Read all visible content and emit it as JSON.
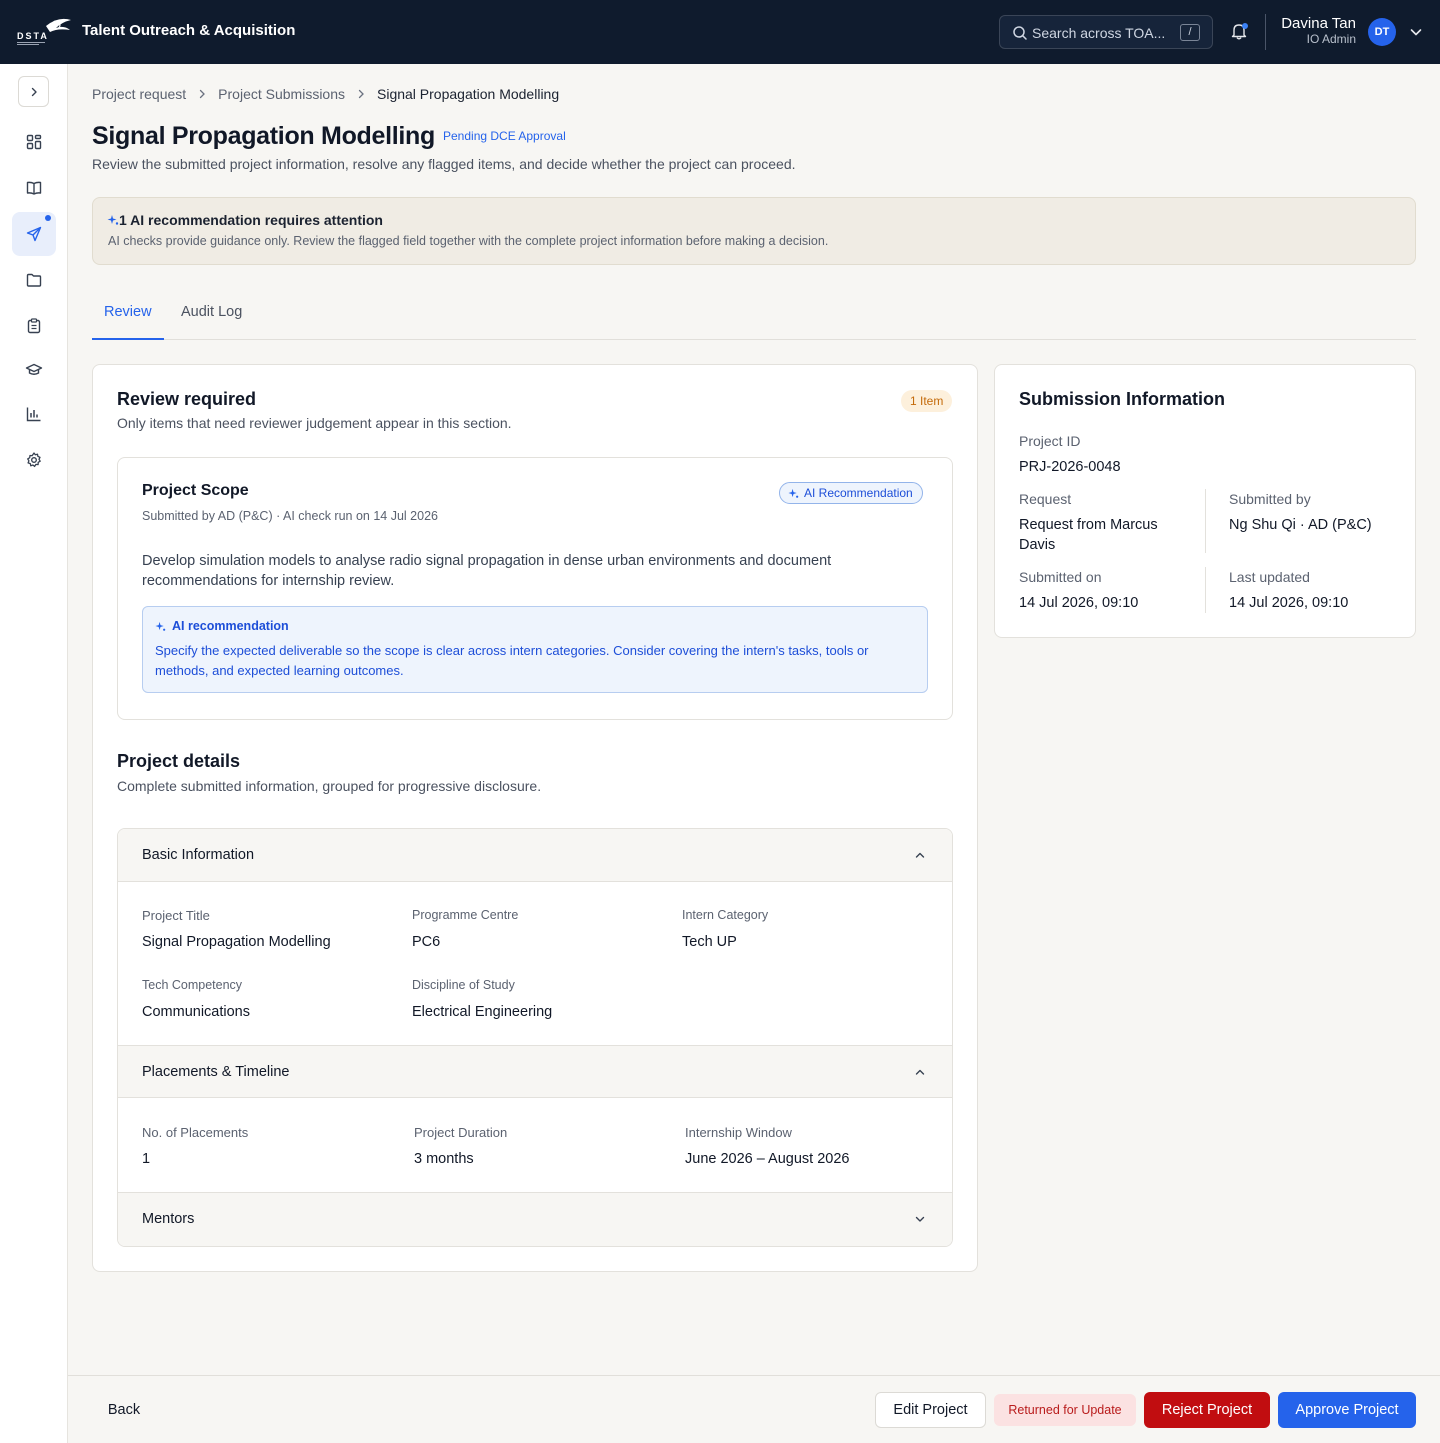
{
  "app": {
    "title": "Talent Outreach & Acquisition",
    "logo_text": "DSTA"
  },
  "search": {
    "placeholder": "Search across TOA...",
    "shortcut": "/"
  },
  "user": {
    "name": "Davina Tan",
    "role": "IO Admin",
    "initials": "DT"
  },
  "sidebar": {
    "items": [
      {
        "icon": "dashboard-icon",
        "active": false
      },
      {
        "icon": "book-icon",
        "active": false
      },
      {
        "icon": "send-icon",
        "active": true,
        "has_indicator": true
      },
      {
        "icon": "folder-icon",
        "active": false
      },
      {
        "icon": "clipboard-icon",
        "active": false
      },
      {
        "icon": "graduation-cap-icon",
        "active": false
      },
      {
        "icon": "bar-chart-icon",
        "active": false
      },
      {
        "icon": "gear-icon",
        "active": false
      }
    ]
  },
  "breadcrumb": [
    "Project request",
    "Project Submissions",
    "Signal Propagation Modelling"
  ],
  "page": {
    "title": "Signal Propagation Modelling",
    "status": "Pending DCE Approval",
    "subtitle": "Review the submitted project information, resolve any flagged items, and decide whether the project can proceed."
  },
  "alert": {
    "title": "1 AI recommendation requires attention",
    "text": "AI checks provide guidance only. Review the flagged field together with the complete project information before making a decision."
  },
  "tabs": [
    {
      "label": "Review",
      "active": true
    },
    {
      "label": "Audit Log",
      "active": false
    }
  ],
  "review": {
    "title": "Review required",
    "subtitle": "Only items that need reviewer judgement appear in this section.",
    "count_badge": "1 Item",
    "item": {
      "title": "Project Scope",
      "meta": "Submitted by AD (P&C) · AI check run on 14 Jul 2026",
      "pill": "AI Recommendation",
      "description": "Develop simulation models to analyse radio signal propagation in dense urban environments and document recommendations for internship review.",
      "ai_heading": "AI recommendation",
      "ai_text": "Specify the expected deliverable so the scope is clear across intern categories. Consider covering the intern's tasks, tools or methods, and expected learning outcomes."
    }
  },
  "details": {
    "title": "Project details",
    "subtitle": "Complete submitted information, grouped for progressive disclosure.",
    "basic": {
      "heading": "Basic Information",
      "project_title_label": "Project Title",
      "project_title": "Signal Propagation Modelling",
      "centre_label": "Programme Centre",
      "centre": "PC6",
      "category_label": "Intern Category",
      "category": "Tech UP",
      "competency_label": "Tech Competency",
      "competency": "Communications",
      "discipline_label": "Discipline of Study",
      "discipline": "Electrical Engineering"
    },
    "placements": {
      "heading": "Placements & Timeline",
      "count_label": "No. of Placements",
      "count": "1",
      "duration_label": "Project Duration",
      "duration": "3 months",
      "window_label": "Internship Window",
      "window": "June 2026 – August 2026"
    },
    "mentors": {
      "heading": "Mentors"
    }
  },
  "submission": {
    "title": "Submission Information",
    "project_id_label": "Project ID",
    "project_id": "PRJ-2026-0048",
    "request_label": "Request",
    "request": "Request from Marcus Davis",
    "submitted_by_label": "Submitted by",
    "submitted_by": "Ng Shu Qi · AD (P&C)",
    "submitted_on_label": "Submitted on",
    "submitted_on": "14 Jul 2026, 09:10",
    "updated_label": "Last updated",
    "updated": "14 Jul 2026, 09:10"
  },
  "footer": {
    "back": "Back",
    "edit": "Edit Project",
    "return": "Returned for Update",
    "reject": "Reject Project",
    "approve": "Approve Project"
  },
  "colors": {
    "topbar": "#0f1b2d",
    "accent": "#2563eb",
    "danger": "#c10d10",
    "warning": "#c46a0a"
  }
}
